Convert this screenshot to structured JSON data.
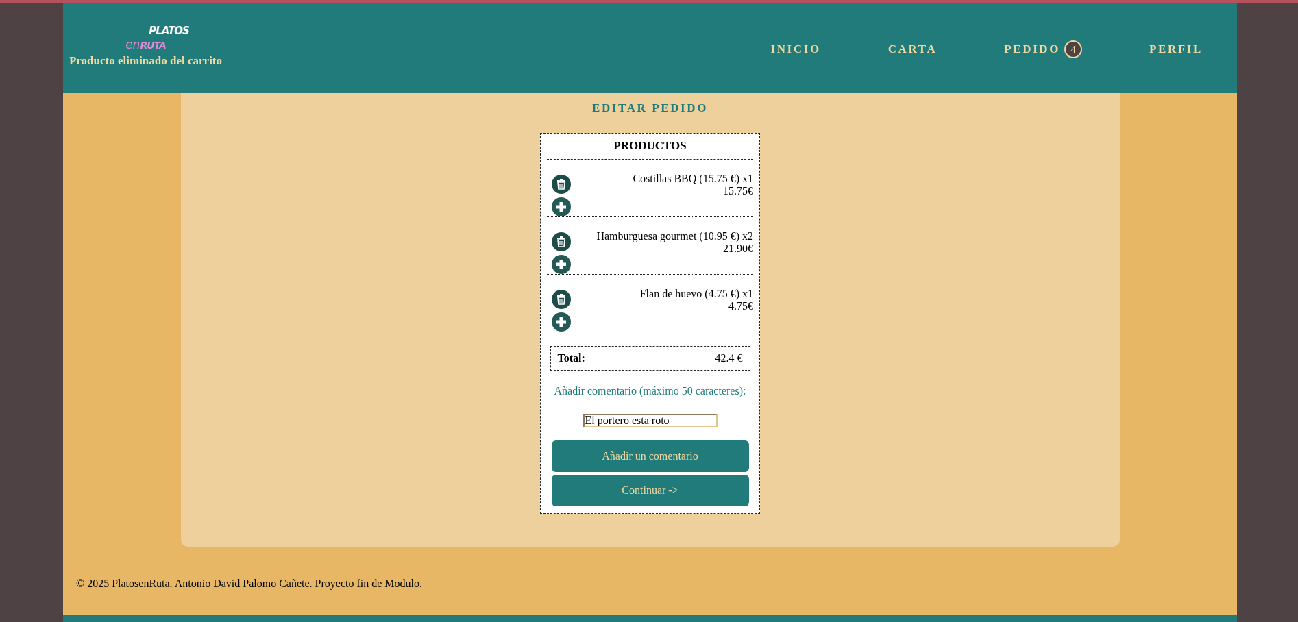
{
  "header": {
    "logo": {
      "top": "PLATOS",
      "middle_light": "en",
      "middle_bold": "RUTA"
    },
    "message": "Producto eliminado del carrito",
    "nav": [
      {
        "label": "INICIO",
        "selected": false
      },
      {
        "label": "CARTA",
        "selected": false
      },
      {
        "label": "PEDIDO",
        "selected": false,
        "badge": "4"
      },
      {
        "label": "PERFIL",
        "selected": false
      }
    ]
  },
  "page_title": "EDITAR PEDIDO",
  "order": {
    "heading": "PRODUCTOS",
    "items": [
      {
        "name": "Costillas BBQ (15.75 €) x1",
        "subtotal": "15.75€"
      },
      {
        "name": "Hamburguesa gourmet (10.95 €) x2",
        "subtotal": "21.90€"
      },
      {
        "name": "Flan de huevo (4.75 €) x1",
        "subtotal": "4.75€"
      }
    ],
    "total_label": "Total:",
    "total_value": "42.4 €",
    "comment_label": "Añadir comentario (máximo 50 caracteres):",
    "comment_value": "El portero esta roto",
    "buttons": [
      "Añadir un comentario",
      "Continuar ->"
    ]
  },
  "footer": "© 2025 PlatosenRuta. Antonio David Palomo Cañete. Proyecto fin de Modulo."
}
